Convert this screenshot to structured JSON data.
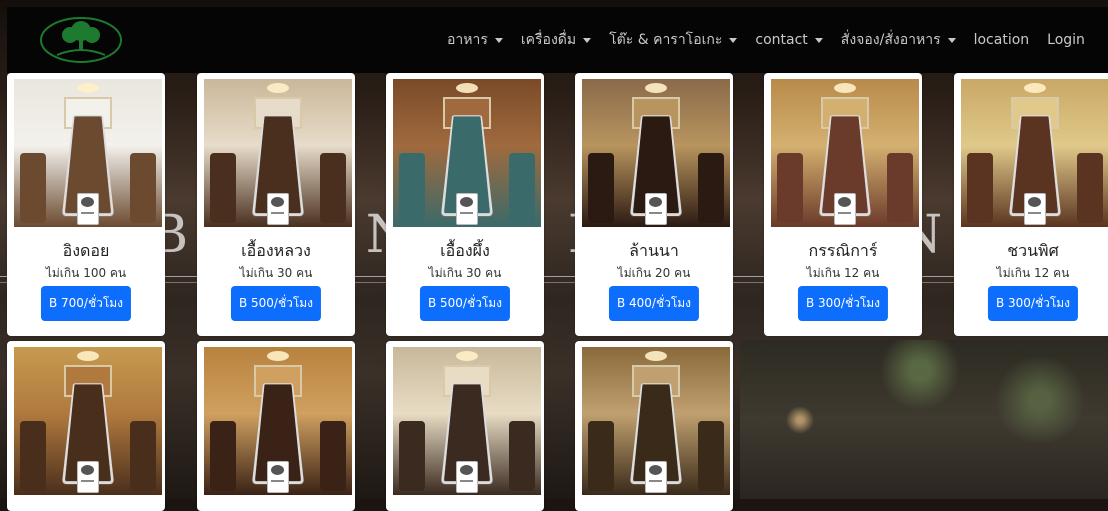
{
  "nav": {
    "items": [
      {
        "label": "อาหาร",
        "dropdown": true
      },
      {
        "label": "เครื่องดื่ม",
        "dropdown": true
      },
      {
        "label": "โต๊ะ & คาราโอเกะ",
        "dropdown": true
      },
      {
        "label": "contact",
        "dropdown": true
      },
      {
        "label": "สั่งจอง/สั่งอาหาร",
        "dropdown": true
      },
      {
        "label": "location",
        "dropdown": false
      },
      {
        "label": "Login",
        "dropdown": false
      }
    ]
  },
  "background_text": "BAN RUAN",
  "rooms": [
    {
      "name": "อิงดอย",
      "capacity": "ไม่เกิน 100 คน",
      "price": "B 700/ชั่วโมง",
      "palette": [
        "#e9e6dd",
        "#6b4a2f",
        "#f3f1ec"
      ]
    },
    {
      "name": "เอื้องหลวง",
      "capacity": "ไม่เกิน 30 คน",
      "price": "B 500/ชั่วโมง",
      "palette": [
        "#cbb79a",
        "#4a2e1e",
        "#e6dcc9"
      ]
    },
    {
      "name": "เอื้องผึ้ง",
      "capacity": "ไม่เกิน 30 คน",
      "price": "B 500/ชั่วโมง",
      "palette": [
        "#7a4a28",
        "#3a6a6a",
        "#a06a3e"
      ]
    },
    {
      "name": "ล้านนา",
      "capacity": "ไม่เกิน 20 คน",
      "price": "B 400/ชั่วโมง",
      "palette": [
        "#8a6a4a",
        "#2b1a12",
        "#b8945e"
      ]
    },
    {
      "name": "กรรณิการ์",
      "capacity": "ไม่เกิน 12 คน",
      "price": "B 300/ชั่วโมง",
      "palette": [
        "#b88a4a",
        "#6a3a2a",
        "#d4b070"
      ]
    },
    {
      "name": "ชวนพิศ",
      "capacity": "ไม่เกิน 12 คน",
      "price": "B 300/ชั่วโมง",
      "palette": [
        "#c9a865",
        "#5a3420",
        "#e0c98a"
      ]
    }
  ],
  "rooms_row2": [
    {
      "palette": [
        "#c79a50",
        "#4a2e1c",
        "#b07a3e"
      ]
    },
    {
      "palette": [
        "#b8823e",
        "#3a2216",
        "#d0a060"
      ]
    },
    {
      "palette": [
        "#c8b89a",
        "#3a2a20",
        "#e8dcc4"
      ]
    },
    {
      "palette": [
        "#8a6a3a",
        "#3a2a1a",
        "#c0a070"
      ]
    }
  ]
}
